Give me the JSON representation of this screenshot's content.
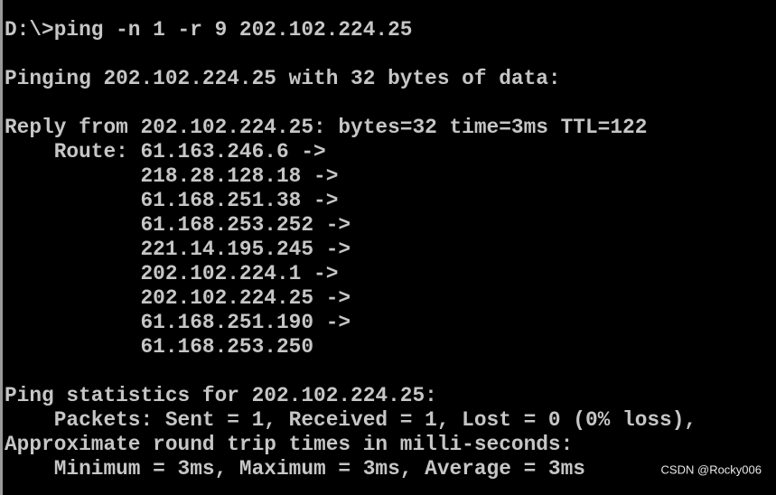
{
  "console": {
    "lines": [
      "D:\\>ping -n 1 -r 9 202.102.224.25",
      "",
      "Pinging 202.102.224.25 with 32 bytes of data:",
      "",
      "Reply from 202.102.224.25: bytes=32 time=3ms TTL=122",
      "    Route: 61.163.246.6 ->",
      "           218.28.128.18 ->",
      "           61.168.251.38 ->",
      "           61.168.253.252 ->",
      "           221.14.195.245 ->",
      "           202.102.224.1 ->",
      "           202.102.224.25 ->",
      "           61.168.251.190 ->",
      "           61.168.253.250",
      "",
      "Ping statistics for 202.102.224.25:",
      "    Packets: Sent = 1, Received = 1, Lost = 0 (0% loss),",
      "Approximate round trip times in milli-seconds:",
      "    Minimum = 3ms, Maximum = 3ms, Average = 3ms"
    ]
  },
  "watermark": "CSDN @Rocky006",
  "colors": {
    "background": "#000000",
    "text": "#c6c6c6"
  }
}
